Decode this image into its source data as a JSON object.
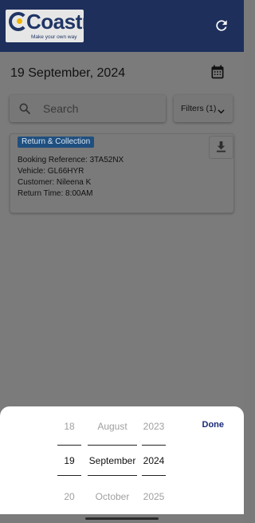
{
  "header": {
    "logo_word": "Coastr",
    "logo_tagline": "Make your own way",
    "colors": {
      "bar": "#1e2f5c"
    }
  },
  "date_bar": {
    "date": "19 September, 2024"
  },
  "search": {
    "placeholder": "Search"
  },
  "filters": {
    "label": "Filters (1)"
  },
  "booking_card": {
    "badge": "Return & Collection",
    "lines": [
      "Booking Reference: 3TA52NX",
      "Vehicle: GL66HYR",
      "Customer: Nileena K",
      "Return Time: 8:00AM"
    ]
  },
  "date_picker": {
    "done_label": "Done",
    "day": {
      "prev": "18",
      "current": "19",
      "next": "20"
    },
    "month": {
      "prev": "August",
      "current": "September",
      "next": "October"
    },
    "year": {
      "prev": "2023",
      "current": "2024",
      "next": "2025"
    }
  }
}
